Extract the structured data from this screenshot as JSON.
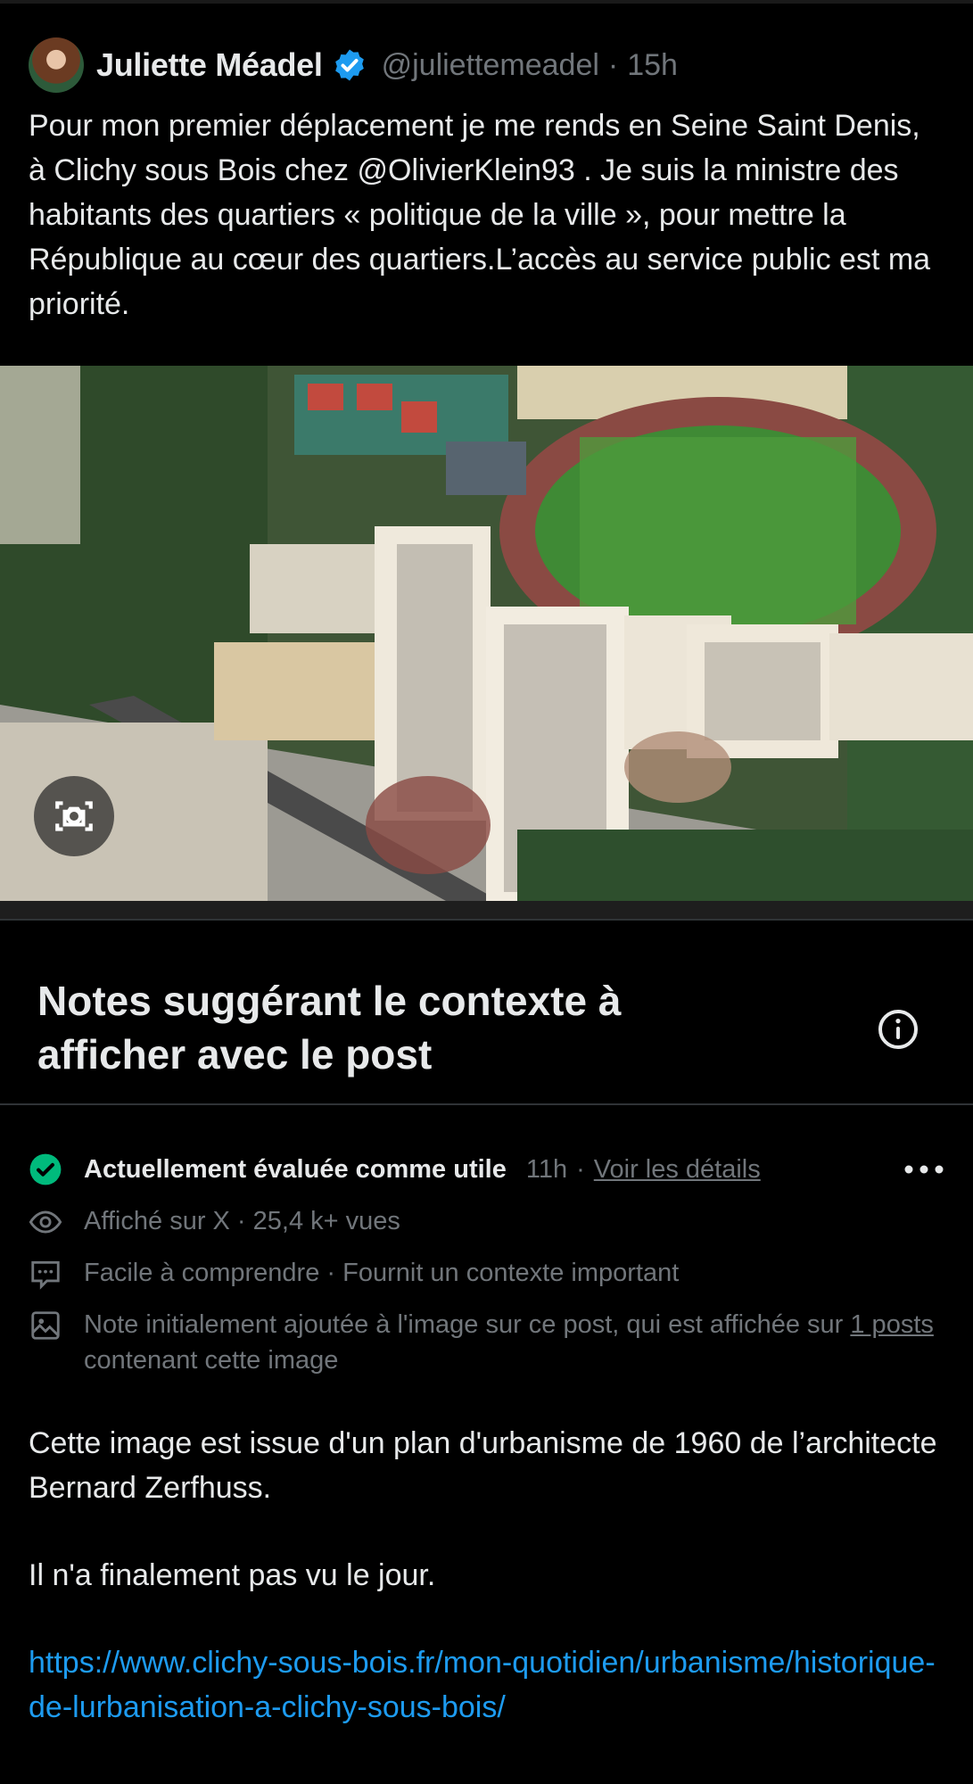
{
  "post": {
    "author_name": "Juliette Méadel",
    "handle": "@juliettemeadel",
    "separator": "·",
    "time": "15h",
    "text": "Pour mon premier déplacement je me rends en Seine Saint Denis, à Clichy sous Bois chez @OlivierKlein93 . Je suis la ministre des habitants des quartiers « politique de la ville », pour mettre la République au cœur des quartiers.L’accès au service public est ma priorité.",
    "image_alt": "",
    "icons": {
      "verified": "verified-badge-icon",
      "lens": "visual-search-icon"
    }
  },
  "notes": {
    "title": "Notes suggérant le contexte à afficher avec le post",
    "info_icon": "info-icon",
    "status": {
      "label": "Actuellement évaluée comme utile",
      "time": "11h",
      "separator": "·",
      "details_link": "Voir les détails",
      "icon": "check-circle-icon",
      "more_icon": "more-icon"
    },
    "meta": {
      "shown": "Affiché sur X · 25,4 k+ vues",
      "ratings": "Facile à comprendre · Fournit un contexte important",
      "image_note_before": "Note initialement ajoutée à l'image sur ce post, qui est affichée sur ",
      "image_note_link": "1 posts",
      "image_note_after": " contenant cette image"
    },
    "body": {
      "paragraph_1": "Cette image est issue d'un plan d'urbanisme de 1960 de l’architecte Bernard Zerfhuss.",
      "paragraph_2": "Il n'a finalement pas vu le jour.",
      "url": "https://www.clichy-sous-bois.fr/mon-quotidien/urbanisme/historique-de-lurbanisation-a-clichy-sous-bois/"
    }
  },
  "colors": {
    "background": "#000000",
    "text": "#e7e9ea",
    "muted": "#71767b",
    "link": "#1d9bf0",
    "verified": "#1d9bf0",
    "check": "#00ba7c"
  }
}
